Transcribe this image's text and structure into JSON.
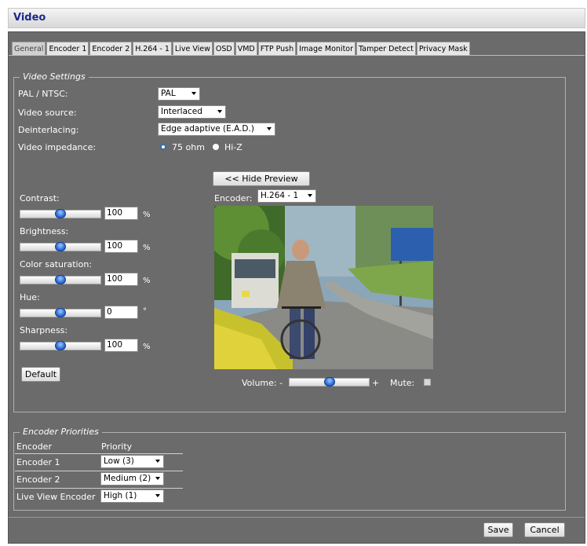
{
  "window": {
    "title": "Video"
  },
  "tabs": [
    "General",
    "Encoder 1",
    "Encoder 2",
    "H.264 - 1",
    "Live View",
    "OSD",
    "VMD",
    "FTP Push",
    "Image Monitor",
    "Tamper Detect",
    "Privacy Mask"
  ],
  "video_settings": {
    "legend": "Video Settings",
    "pal_ntsc_label": "PAL / NTSC:",
    "pal_ntsc_value": "PAL",
    "video_source_label": "Video source:",
    "video_source_value": "Interlaced",
    "deinterlacing_label": "Deinterlacing:",
    "deinterlacing_value": "Edge adaptive (E.A.D.)",
    "impedance_label": "Video impedance:",
    "impedance_options": [
      "75 ohm",
      "Hi-Z"
    ],
    "impedance_selected": "75 ohm"
  },
  "adjustments": {
    "contrast": {
      "label": "Contrast:",
      "value": "100",
      "unit": "%",
      "level": 0.5
    },
    "brightness": {
      "label": "Brightness:",
      "value": "100",
      "unit": "%",
      "level": 0.5
    },
    "color_saturation": {
      "label": "Color saturation:",
      "value": "100",
      "unit": "%",
      "level": 0.5
    },
    "hue": {
      "label": "Hue:",
      "value": "0",
      "unit": "°",
      "level": 0.5
    },
    "sharpness": {
      "label": "Sharpness:",
      "value": "100",
      "unit": "%",
      "level": 0.5
    },
    "default_label": "Default"
  },
  "preview": {
    "hide_label": "<< Hide Preview",
    "encoder_label": "Encoder:",
    "encoder_value": "H.264 - 1",
    "volume_label": "Volume: -",
    "volume_plus": "+",
    "volume_level": 0.5,
    "mute_label": "Mute:"
  },
  "encoder_priorities": {
    "legend": "Encoder Priorities",
    "headers": [
      "Encoder",
      "Priority"
    ],
    "rows": [
      {
        "name": "Encoder 1",
        "priority": "Low (3)"
      },
      {
        "name": "Encoder 2",
        "priority": "Medium (2)"
      },
      {
        "name": "Live View Encoder",
        "priority": "High (1)"
      }
    ]
  },
  "footer": {
    "save_label": "Save",
    "cancel_label": "Cancel"
  },
  "colors": {
    "panel": "#6b6b6b",
    "title": "#1a2a8c",
    "knob": "#1f5fcf"
  }
}
